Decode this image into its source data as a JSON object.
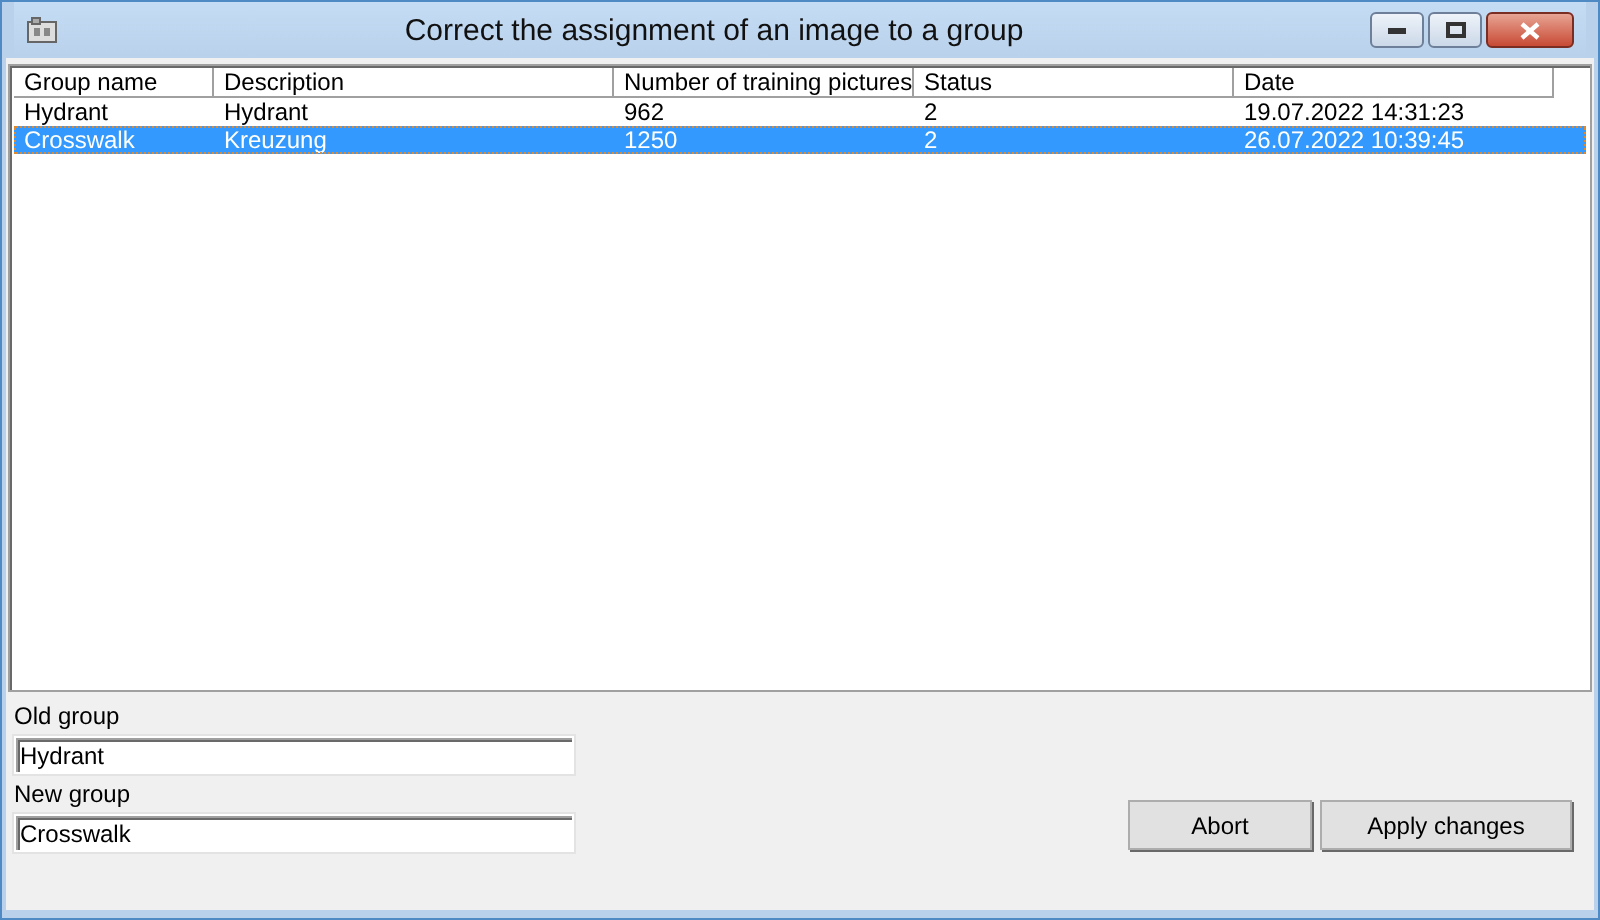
{
  "window": {
    "title": "Correct the assignment of an image to a group"
  },
  "table": {
    "columns": [
      "Group name",
      "Description",
      "Number of training pictures",
      "Status",
      "Date"
    ],
    "rows": [
      {
        "cells": [
          "Hydrant",
          "Hydrant",
          "962",
          "2",
          "19.07.2022 14:31:23"
        ],
        "selected": false
      },
      {
        "cells": [
          "Crosswalk",
          "Kreuzung",
          "1250",
          "2",
          "26.07.2022 10:39:45"
        ],
        "selected": true
      }
    ]
  },
  "old_group": {
    "label": "Old group",
    "value": "Hydrant"
  },
  "new_group": {
    "label": "New group",
    "value": "Crosswalk"
  },
  "buttons": [
    "Abort",
    "Apply changes"
  ]
}
